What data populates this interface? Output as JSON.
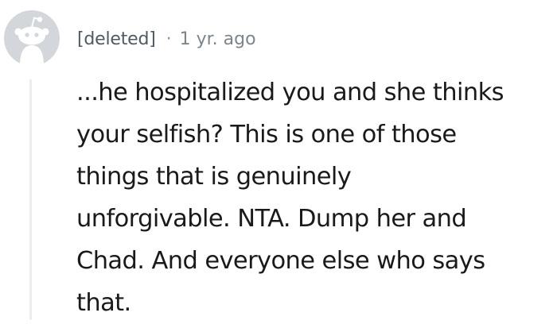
{
  "comment": {
    "author": "[deleted]",
    "separator": "·",
    "timestamp": "1 yr. ago",
    "body_lines": [
      "...he hospitalized you and she thinks",
      "your selfish? This is one of those",
      "things that is genuinely",
      "unforgivable. NTA. Dump her and",
      "Chad. And everyone else who says",
      "that."
    ]
  },
  "icons": {
    "avatar": "reddit-snoo-avatar-icon"
  },
  "colors": {
    "avatar_fill": "#d3d6da",
    "thread_line": "#ebedef",
    "text": "#1a1a1b",
    "meta_text": "#7c858c"
  }
}
